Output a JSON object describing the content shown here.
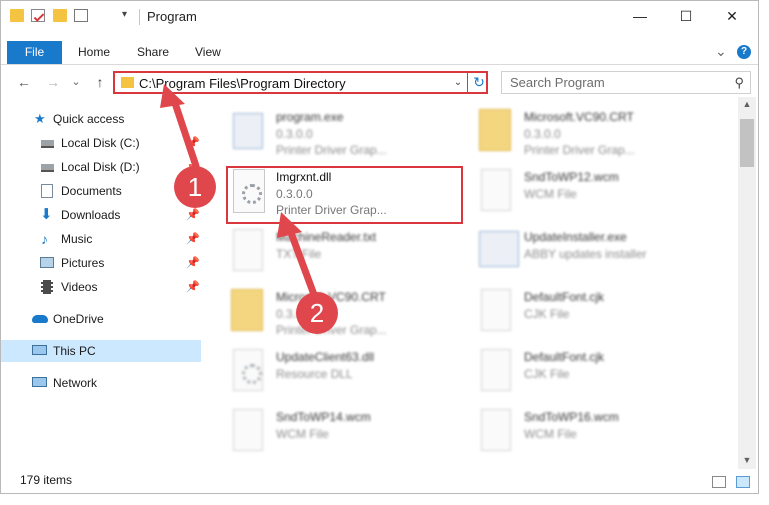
{
  "window": {
    "title": "Program"
  },
  "title_controls": {
    "minimize": "—",
    "maximize": "☐",
    "close": "✕"
  },
  "ribbon": {
    "tabs": [
      {
        "label": "File"
      },
      {
        "label": "Home"
      },
      {
        "label": "Share"
      },
      {
        "label": "View"
      }
    ],
    "expand": "⌄",
    "help": "?"
  },
  "nav": {
    "back": "←",
    "forward": "→",
    "recent": "⌄",
    "up": "↑"
  },
  "address": {
    "path": "C:\\Program Files\\Program Directory",
    "dropdown": "⌄",
    "refresh": "↻"
  },
  "search": {
    "placeholder": "Search Program",
    "icon": "search-icon"
  },
  "sidebar": {
    "items": [
      {
        "label": "Quick access",
        "icon": "star-icon"
      },
      {
        "label": "Local Disk (C:)",
        "icon": "drive-icon",
        "pinned": true
      },
      {
        "label": "Local Disk (D:)",
        "icon": "drive-icon",
        "pinned": true
      },
      {
        "label": "Documents",
        "icon": "documents-icon",
        "pinned": true
      },
      {
        "label": "Downloads",
        "icon": "downloads-icon",
        "pinned": true
      },
      {
        "label": "Music",
        "icon": "music-icon",
        "pinned": true
      },
      {
        "label": "Pictures",
        "icon": "pictures-icon",
        "pinned": true
      },
      {
        "label": "Videos",
        "icon": "videos-icon",
        "pinned": true
      },
      {
        "label": "OneDrive",
        "icon": "onedrive-icon"
      },
      {
        "label": "This PC",
        "icon": "computer-icon",
        "selected": true
      },
      {
        "label": "Network",
        "icon": "network-icon"
      }
    ]
  },
  "files": [
    {
      "name": "program.exe",
      "line2": "0.3.0.0",
      "line3": "Printer Driver Grap...",
      "thumb": "app-icon"
    },
    {
      "name": "Microsoft.VC90.CRT",
      "line2": "0.3.0.0",
      "line3": "Printer Driver Grap...",
      "thumb": "folder-icon"
    },
    {
      "name": "Imgrxnt.dll",
      "line2": "0.3.0.0",
      "line3": "Printer Driver Grap...",
      "thumb": "dll-gear-icon",
      "highlighted": true
    },
    {
      "name": "SndToWP12.wcm",
      "line2": "WCM File",
      "line3": "",
      "thumb": "document-icon"
    },
    {
      "name": "MachineReader.txt",
      "line2": "TXT File",
      "line3": "",
      "thumb": "document-icon"
    },
    {
      "name": "UpdateInstaller.exe",
      "line2": "ABBY updates installer",
      "line3": "",
      "thumb": "installer-icon"
    },
    {
      "name": "Microsoft.VC90.CRT",
      "line2": "0.3.0.0",
      "line3": "Printer Driver Grap...",
      "thumb": "folder-icon"
    },
    {
      "name": "DefaultFont.cjk",
      "line2": "CJK File",
      "line3": "",
      "thumb": "document-icon"
    },
    {
      "name": "UpdateClient63.dll",
      "line2": "Resource DLL",
      "line3": "",
      "thumb": "dll-gear-icon"
    },
    {
      "name": "DefaultFont.cjk",
      "line2": "CJK File",
      "line3": "",
      "thumb": "document-icon"
    },
    {
      "name": "SndToWP14.wcm",
      "line2": "WCM File",
      "line3": "",
      "thumb": "document-icon"
    },
    {
      "name": "SndToWP16.wcm",
      "line2": "WCM File",
      "line3": "",
      "thumb": "document-icon"
    }
  ],
  "status": {
    "count": "179 items"
  },
  "annotations": {
    "badge_1": "1",
    "badge_2": "2",
    "color": "#e0474c"
  }
}
